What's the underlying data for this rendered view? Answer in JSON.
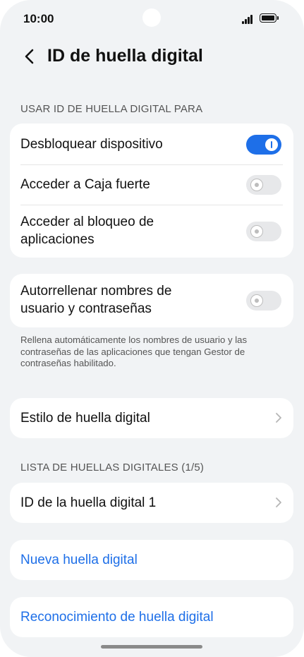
{
  "status_bar": {
    "time": "10:00",
    "icons": [
      "camera-cutout",
      "signal-icon",
      "battery-icon"
    ]
  },
  "header": {
    "back_icon": "chevron-left-icon",
    "title": "ID de huella digital"
  },
  "usage_section": {
    "label": "USAR ID DE HUELLA DIGITAL PARA",
    "items": [
      {
        "label": "Desbloquear dispositivo",
        "enabled": true
      },
      {
        "label": "Acceder a Caja fuerte",
        "enabled": false
      },
      {
        "label_line1": "Acceder al bloqueo de",
        "label_line2": "aplicaciones",
        "enabled": false
      }
    ]
  },
  "autofill": {
    "label_line1": "Autorrellenar nombres de",
    "label_line2": "usuario y contraseñas",
    "enabled": false,
    "helper_text": "Rellena automáticamente los nombres de usuario y las contraseñas de las aplicaciones que tengan Gestor de contraseñas habilitado."
  },
  "style_item": {
    "label": "Estilo de huella digital",
    "icon": "chevron-right-icon"
  },
  "fingerprint_list": {
    "label": "LISTA DE HUELLAS DIGITALES (1/5)",
    "items": [
      {
        "label": "ID de la huella digital 1",
        "icon": "chevron-right-icon"
      }
    ]
  },
  "actions": {
    "new_fingerprint": "Nueva huella digital",
    "recognition": "Reconocimiento de huella digital"
  },
  "colors": {
    "accent": "#1e6fe8",
    "background": "#f1f3f5",
    "card": "#ffffff"
  }
}
